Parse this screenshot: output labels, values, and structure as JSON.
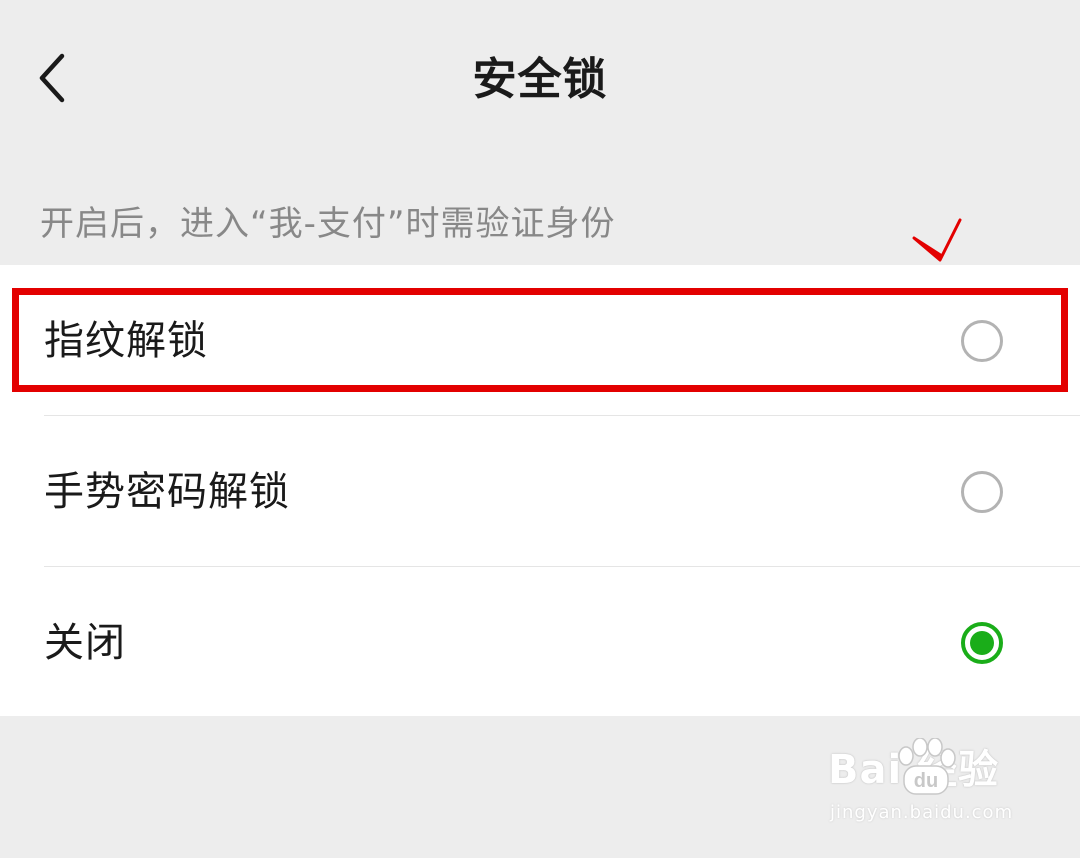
{
  "nav": {
    "title": "安全锁",
    "back_icon": "chevron-left-icon"
  },
  "hint": "开启后，进入“我-支付”时需验证身份",
  "options": [
    {
      "label": "指纹解锁",
      "selected": false
    },
    {
      "label": "手势密码解锁",
      "selected": false
    },
    {
      "label": "关闭",
      "selected": true
    }
  ],
  "annotation": {
    "highlight_color": "#e30000",
    "highlighted_option": "指纹解锁",
    "check_icon": "check-mark-icon"
  },
  "colors": {
    "accent": "#1aad19",
    "background": "#ededed",
    "card": "#ffffff",
    "hint_text": "#888888",
    "radio_border": "#b3b3b3"
  },
  "watermark": {
    "brand": "Bai  经验",
    "url": "jingyan.baidu.com"
  }
}
